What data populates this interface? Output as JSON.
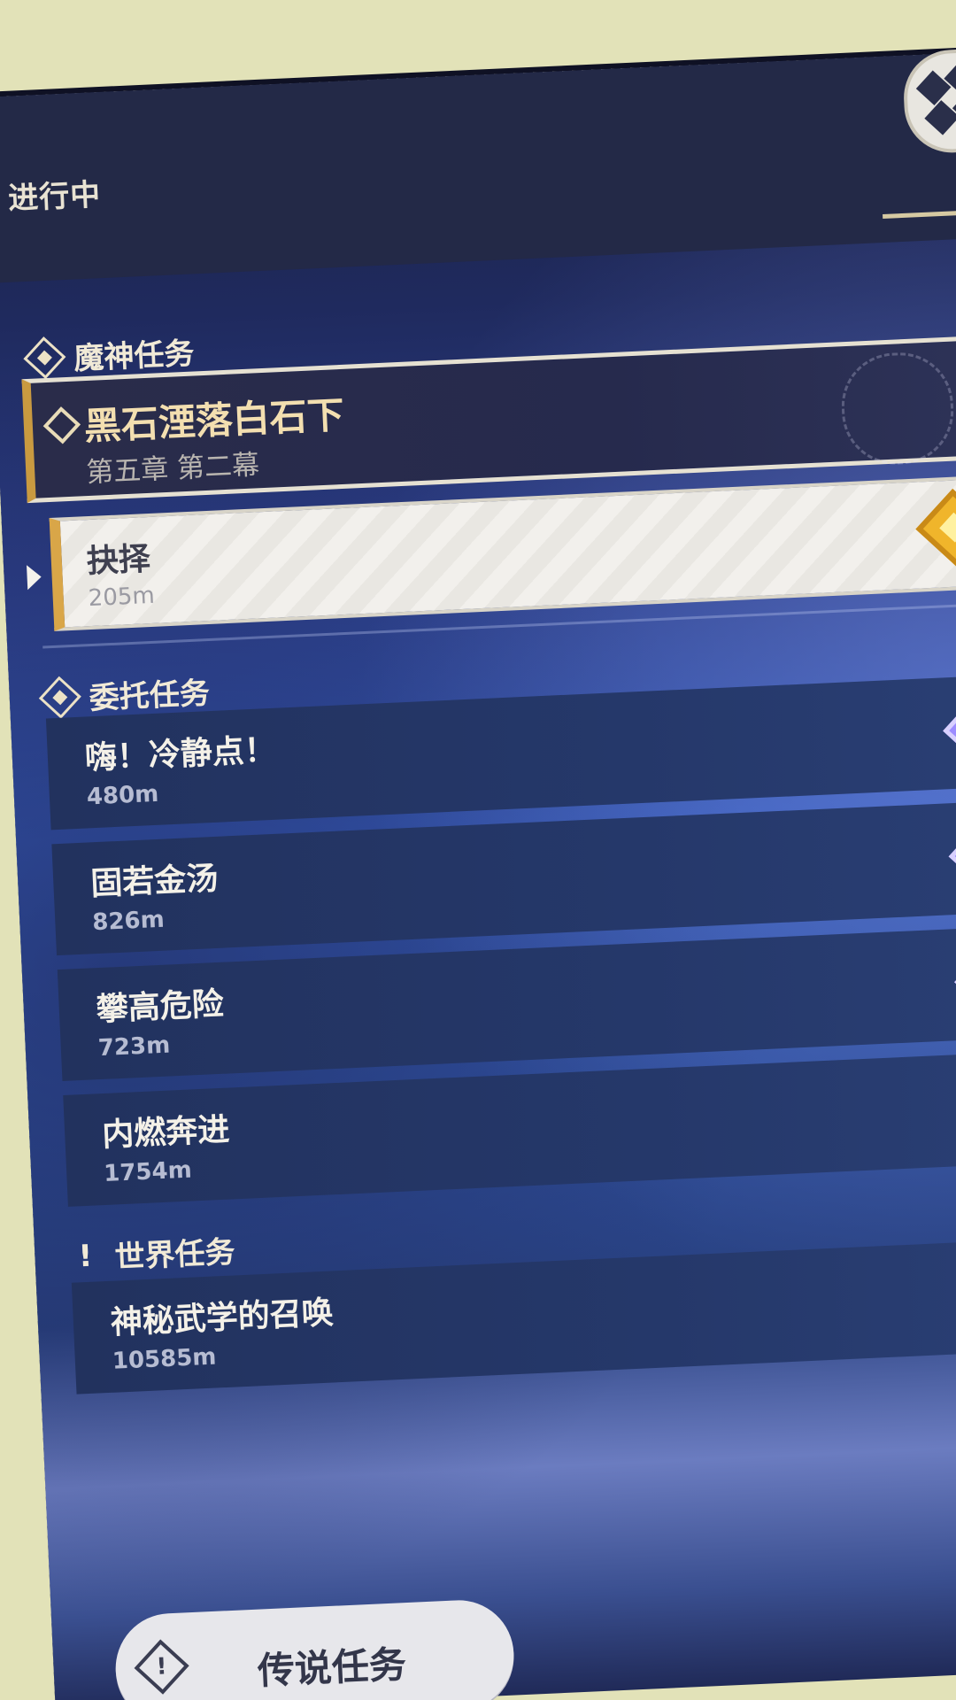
{
  "header": {
    "tab_label": "进行中",
    "map_button_icon": "map-grid-icon"
  },
  "archon": {
    "section_title": "魔神任务",
    "section_icon": "archon-quest-icon",
    "quest": {
      "title": "黑石湮落白石下",
      "subtitle": "第五章 第二幕",
      "icon": "archon-quest-marker-icon",
      "accent": "#c99a40"
    },
    "tracked_subquest": {
      "title": "抉择",
      "distance": "205m",
      "marker_icon": "gold-quest-marker-icon",
      "marker_color": "#f0b52b"
    }
  },
  "commission": {
    "section_title": "委托任务",
    "section_icon": "commission-quest-icon",
    "items": [
      {
        "title": "嗨！冷静点！",
        "distance": "480m"
      },
      {
        "title": "固若金汤",
        "distance": "826m"
      },
      {
        "title": "攀高危险",
        "distance": "723m"
      },
      {
        "title": "内燃奔进",
        "distance": "1754m"
      }
    ],
    "marker_color": "#9c8cff"
  },
  "world": {
    "section_title": "世界任务",
    "section_icon": "exclamation-icon",
    "items": [
      {
        "title": "神秘武学的召唤",
        "distance": "10585m"
      }
    ]
  },
  "footer": {
    "legend_button_label": "传说任务",
    "legend_icon_glyph": "!"
  }
}
